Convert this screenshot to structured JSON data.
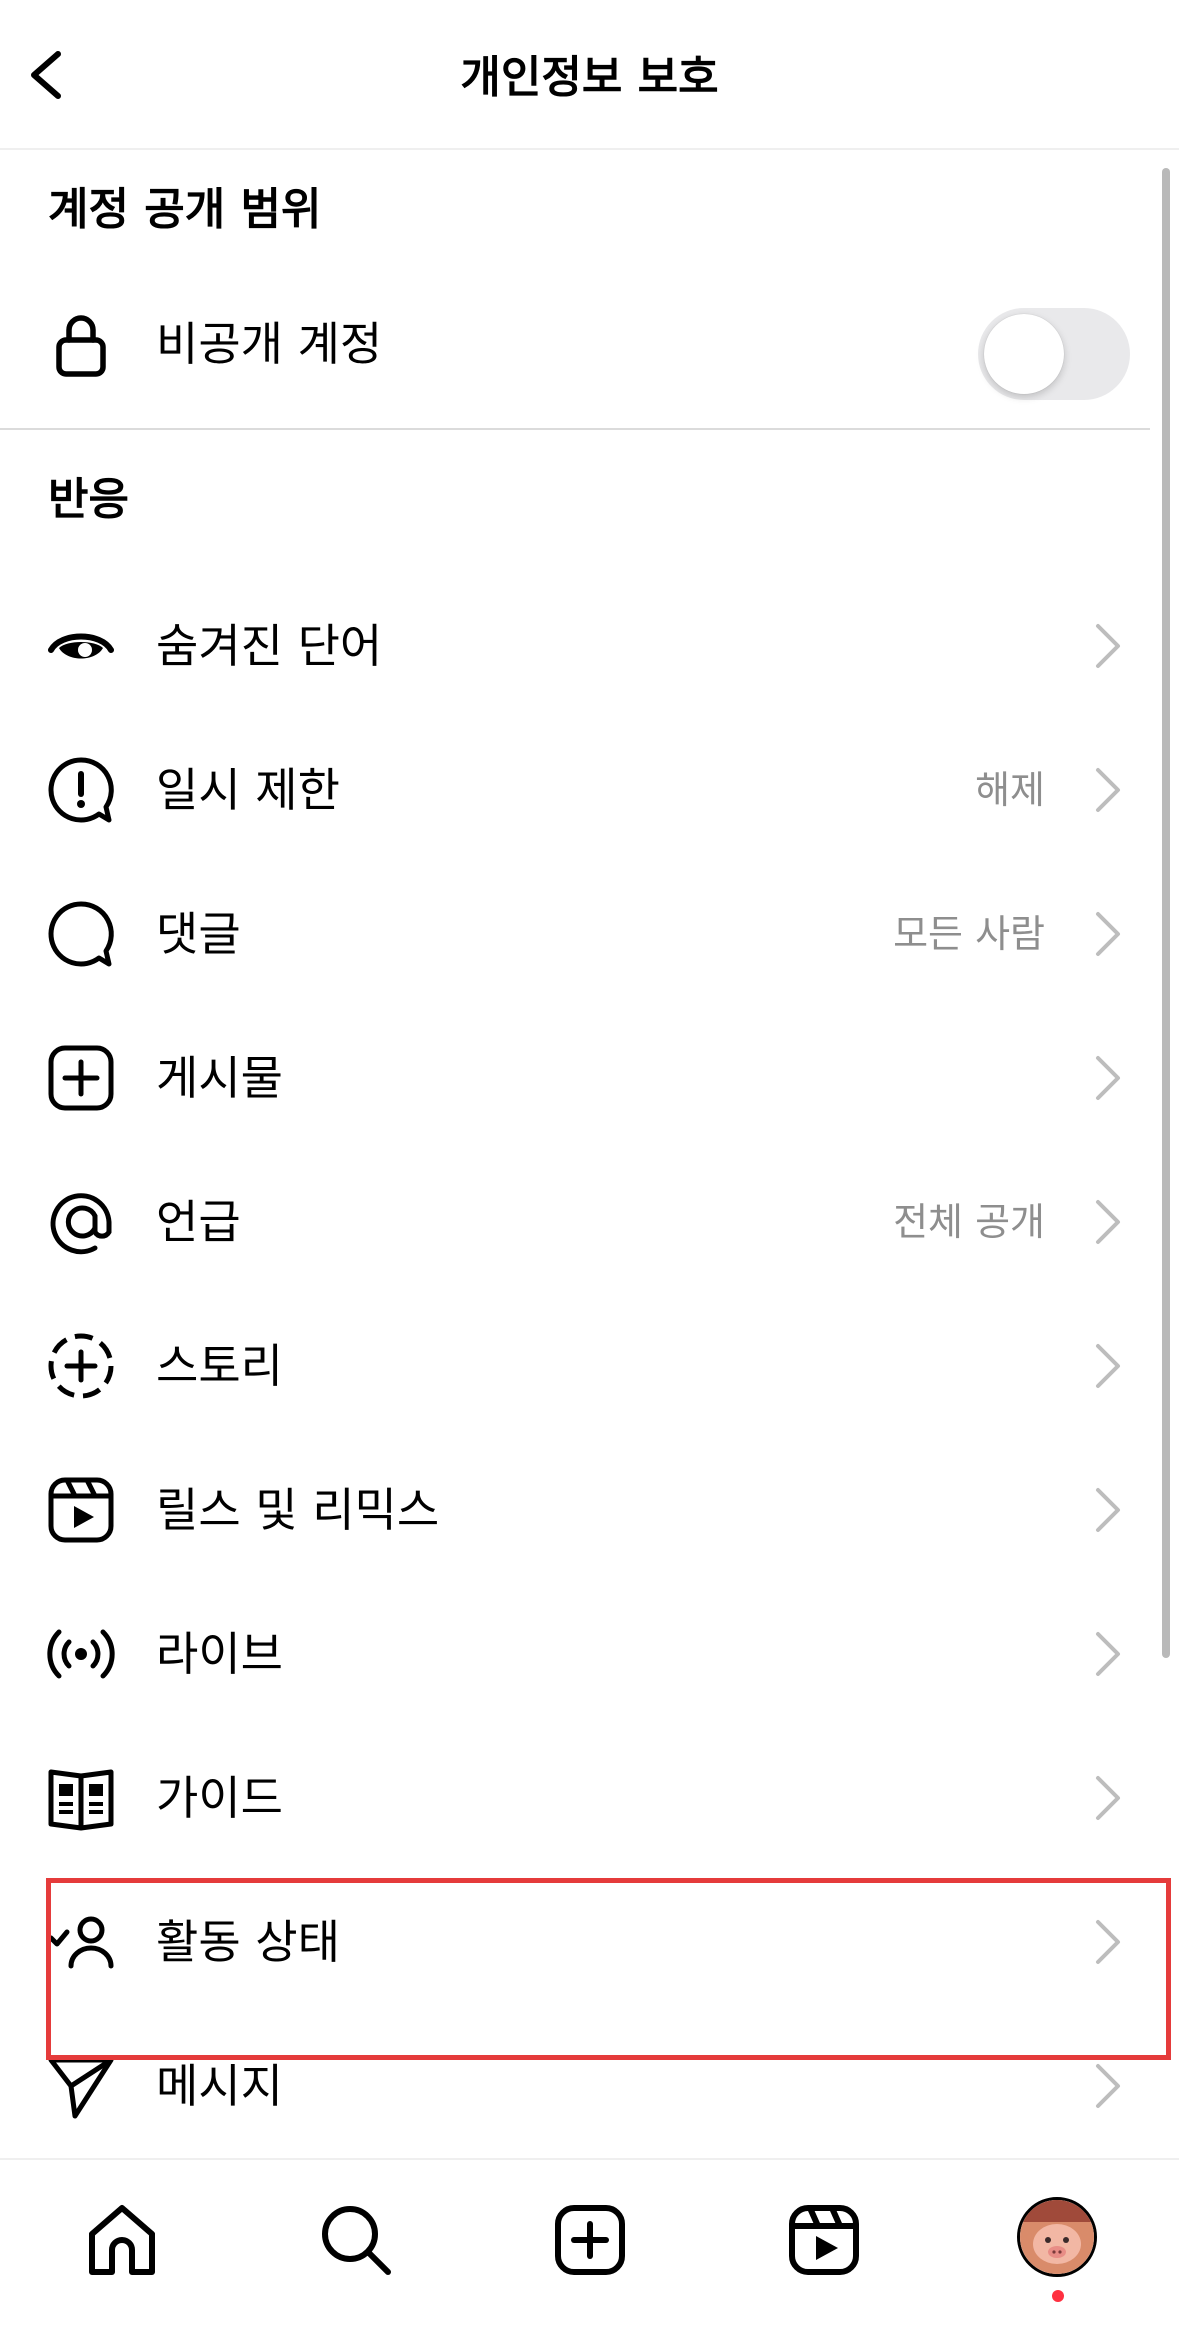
{
  "header": {
    "title": "개인정보 보호"
  },
  "account_visibility": {
    "section_title": "계정 공개 범위",
    "private_account_label": "비공개 계정",
    "private_account_enabled": false
  },
  "interactions": {
    "section_title": "반응",
    "items": [
      {
        "label": "숨겨진 단어",
        "value": "",
        "icon": "hidden-words-icon"
      },
      {
        "label": "일시 제한",
        "value": "해제",
        "icon": "restrict-icon"
      },
      {
        "label": "댓글",
        "value": "모든 사람",
        "icon": "comment-icon"
      },
      {
        "label": "게시물",
        "value": "",
        "icon": "post-add-icon"
      },
      {
        "label": "언급",
        "value": "전체 공개",
        "icon": "mention-icon"
      },
      {
        "label": "스토리",
        "value": "",
        "icon": "story-add-icon"
      },
      {
        "label": "릴스 및 리믹스",
        "value": "",
        "icon": "reels-icon"
      },
      {
        "label": "라이브",
        "value": "",
        "icon": "live-icon"
      },
      {
        "label": "가이드",
        "value": "",
        "icon": "guide-icon"
      },
      {
        "label": "활동 상태",
        "value": "",
        "icon": "activity-status-icon"
      },
      {
        "label": "메시지",
        "value": "",
        "icon": "message-send-icon"
      }
    ]
  },
  "bottom_nav": {
    "items": [
      "home-icon",
      "search-icon",
      "create-icon",
      "reels-icon",
      "profile-avatar"
    ]
  },
  "colors": {
    "highlight": "#e53b3b",
    "secondary_text": "#8e8e8e",
    "notification_dot": "#ff3040"
  }
}
